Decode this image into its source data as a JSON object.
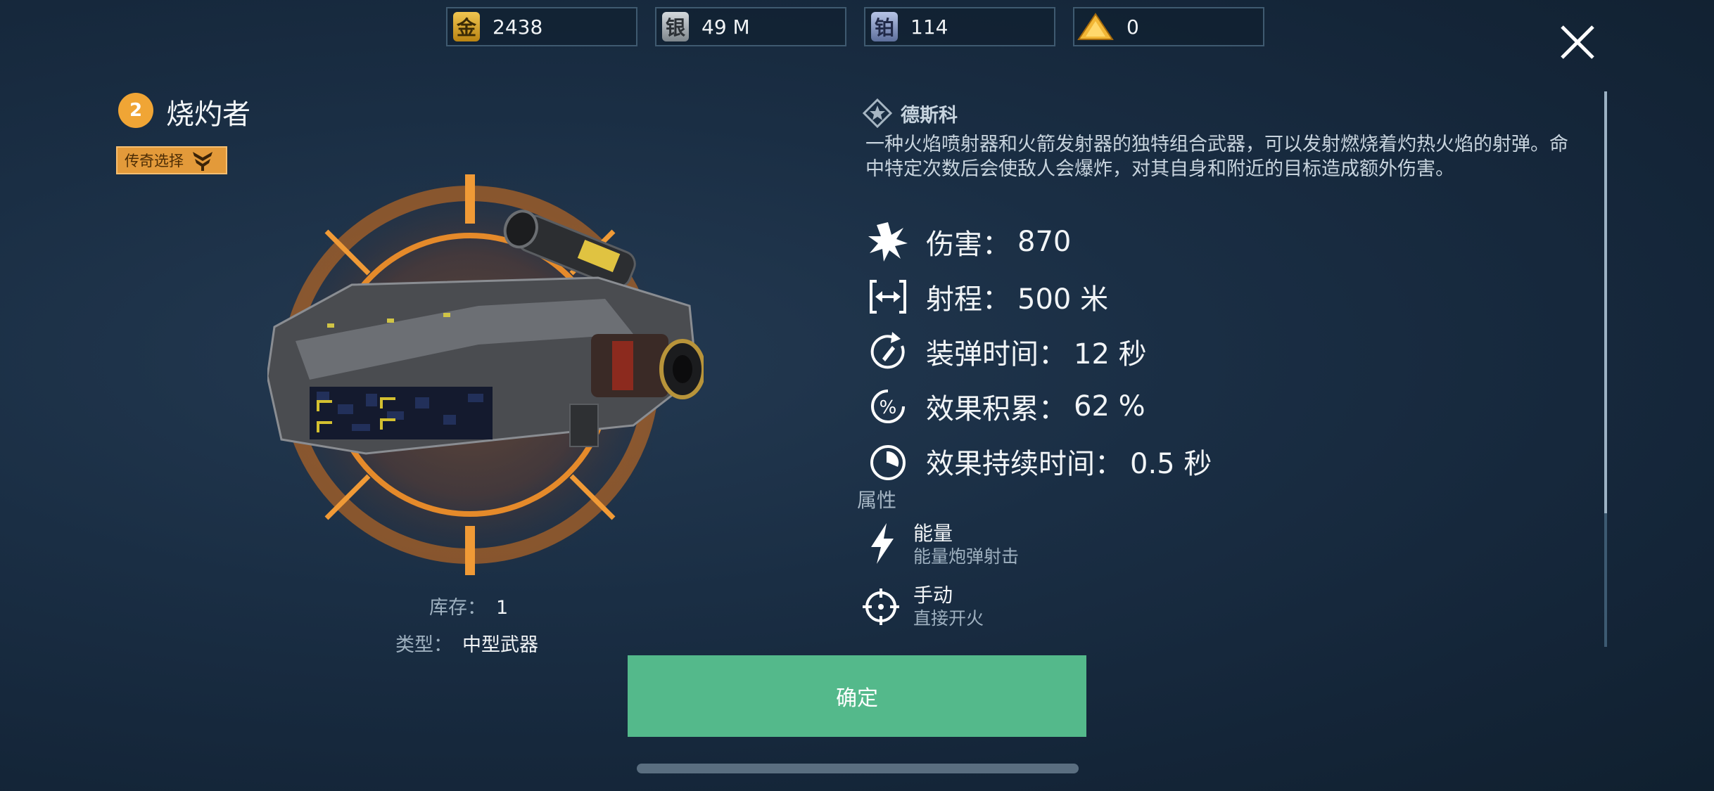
{
  "currencies": [
    {
      "icon": "gold-currency-icon",
      "glyph": "金",
      "value": "2438",
      "color": "#d7a62c"
    },
    {
      "icon": "silver-currency-icon",
      "glyph": "银",
      "value": "49 M",
      "color": "#a9b0b6"
    },
    {
      "icon": "platinum-currency-icon",
      "glyph": "铂",
      "value": "114",
      "color": "#8ea0c8"
    },
    {
      "icon": "key-currency-icon",
      "glyph": "",
      "value": "0",
      "color": "#e3a933"
    }
  ],
  "weapon": {
    "level": "2",
    "name": "烧灼者",
    "tag": "传奇选择",
    "stock_label": "库存：",
    "stock_value": "1",
    "type_label": "类型：",
    "type_value": "中型武器"
  },
  "details": {
    "manufacturer": "德斯科",
    "description": "一种火焰喷射器和火箭发射器的独特组合武器，可以发射燃烧着灼热火焰的射弹。命中特定次数后会使敌人会爆炸，对其自身和附近的目标造成额外伤害。",
    "stats": [
      {
        "icon": "damage-burst-icon",
        "label": "伤害：",
        "value": "870"
      },
      {
        "icon": "range-icon",
        "label": "射程：",
        "value": "500 米"
      },
      {
        "icon": "reload-icon",
        "label": "装弹时间：",
        "value": "12 秒"
      },
      {
        "icon": "percent-icon",
        "label": "效果积累：",
        "value": "62 %"
      },
      {
        "icon": "duration-clock-icon",
        "label": "效果持续时间：",
        "value": "0.5 秒"
      }
    ],
    "attributes_title": "属性",
    "attributes": [
      {
        "icon": "lightning-icon",
        "name": "能量",
        "desc": "能量炮弹射击"
      },
      {
        "icon": "crosshair-icon",
        "name": "手动",
        "desc": "直接开火"
      }
    ]
  },
  "confirm_label": "确定",
  "colors": {
    "accent_orange": "#f0a535",
    "confirm_green": "#54b98b"
  }
}
